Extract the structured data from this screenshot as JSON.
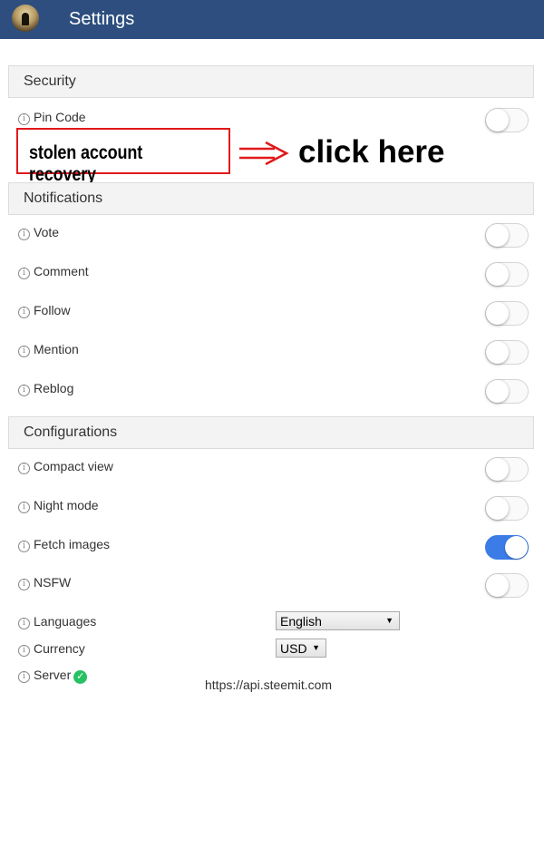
{
  "header": {
    "title": "Settings",
    "avatar_icon": "avatar-icon"
  },
  "security": {
    "title": "Security",
    "pin_code": {
      "label": "Pin Code",
      "enabled": false
    }
  },
  "annotation": {
    "box_text": "stolen account recovery",
    "arrow_text": "click here",
    "box_color": "#e0191b"
  },
  "notifications": {
    "title": "Notifications",
    "vote": {
      "label": "Vote",
      "enabled": false
    },
    "comment": {
      "label": "Comment",
      "enabled": false
    },
    "follow": {
      "label": "Follow",
      "enabled": false
    },
    "mention": {
      "label": "Mention",
      "enabled": false
    },
    "reblog": {
      "label": "Reblog",
      "enabled": false
    }
  },
  "configurations": {
    "title": "Configurations",
    "compact_view": {
      "label": "Compact view",
      "enabled": false
    },
    "night_mode": {
      "label": "Night mode",
      "enabled": false
    },
    "fetch_images": {
      "label": "Fetch images",
      "enabled": true
    },
    "nsfw": {
      "label": "NSFW",
      "enabled": false
    },
    "languages": {
      "label": "Languages",
      "selected": "English"
    },
    "currency": {
      "label": "Currency",
      "selected": "USD"
    },
    "server": {
      "label": "Server",
      "url": "https://api.steemit.com",
      "status": "connected"
    }
  },
  "colors": {
    "header_bg": "#2d4e7e",
    "toggle_on": "#3b7ce6",
    "server_ok": "#27c163"
  }
}
